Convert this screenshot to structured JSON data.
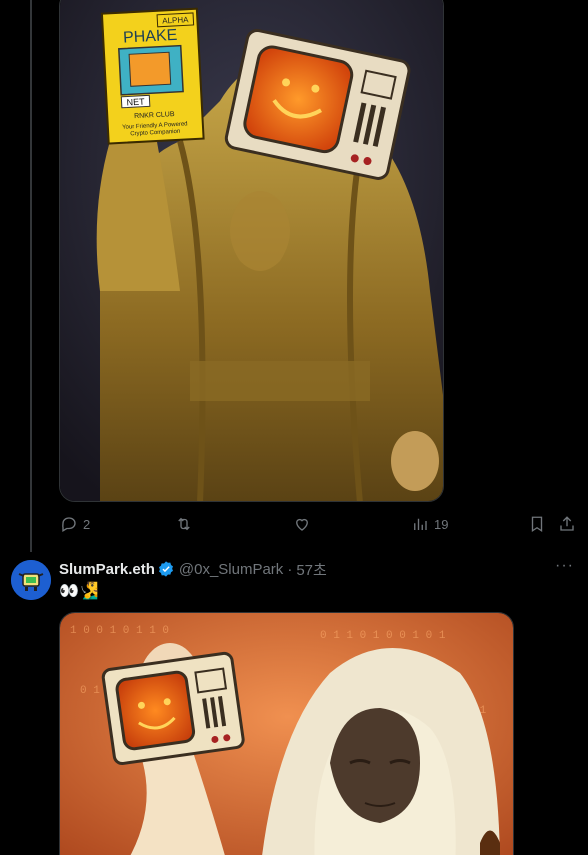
{
  "tweet1": {
    "actions": {
      "reply_count": "2",
      "retweet_count": "",
      "like_count": "",
      "view_count": "19"
    }
  },
  "card": {
    "alpha": "ALPHA",
    "title": "PHAKE",
    "net": "NET",
    "club": "RNKR CLUB",
    "tagline1": "Your Friendly A Powered",
    "tagline2": "Crypto Companion"
  },
  "tweet2": {
    "display_name": "SlumPark.eth",
    "handle": "@0x_SlumPark",
    "separator": "·",
    "time": "57초",
    "text": "👀🧏‍♂️",
    "more": "···"
  },
  "colors": {
    "bg": "#000000",
    "muted": "#71767b",
    "verified": "#1d9bf0",
    "text": "#e7e9ea"
  }
}
